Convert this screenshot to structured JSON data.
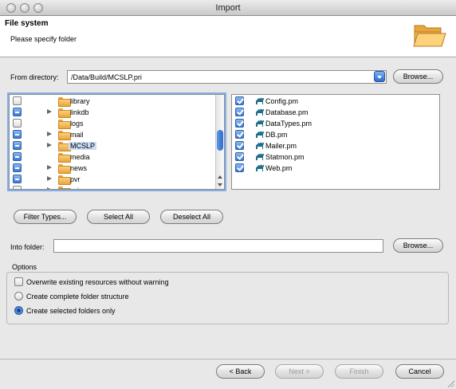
{
  "window": {
    "title": "Import"
  },
  "header": {
    "title": "File system",
    "subtitle": "Please specify folder",
    "icon": "folder-open-icon"
  },
  "from_directory": {
    "label": "From directory:",
    "value": "/Data/Build/MCSLP.pri",
    "browse_label": "Browse..."
  },
  "folder_tree": {
    "items": [
      {
        "label": "library",
        "check": "unchecked",
        "expander": false,
        "selected": false
      },
      {
        "label": "linkdb",
        "check": "mixed",
        "expander": true,
        "selected": false
      },
      {
        "label": "logs",
        "check": "unchecked",
        "expander": false,
        "selected": false
      },
      {
        "label": "mail",
        "check": "mixed",
        "expander": true,
        "selected": false
      },
      {
        "label": "MCSLP",
        "check": "mixed",
        "expander": true,
        "selected": true
      },
      {
        "label": "media",
        "check": "mixed",
        "expander": false,
        "selected": false
      },
      {
        "label": "news",
        "check": "mixed",
        "expander": true,
        "selected": false
      },
      {
        "label": "pvr",
        "check": "mixed",
        "expander": true,
        "selected": false
      },
      {
        "label": "ssi",
        "check": "unchecked",
        "expander": true,
        "selected": false
      }
    ]
  },
  "file_list": {
    "items": [
      {
        "label": "Config.pm",
        "checked": true,
        "icon": "perl-camel-icon"
      },
      {
        "label": "Database.pm",
        "checked": true,
        "icon": "perl-camel-icon"
      },
      {
        "label": "DataTypes.pm",
        "checked": true,
        "icon": "perl-camel-icon"
      },
      {
        "label": "DB.pm",
        "checked": true,
        "icon": "perl-camel-icon"
      },
      {
        "label": "Mailer.pm",
        "checked": true,
        "icon": "perl-camel-icon"
      },
      {
        "label": "Statmon.pm",
        "checked": true,
        "icon": "perl-camel-icon"
      },
      {
        "label": "Web.pm",
        "checked": true,
        "icon": "perl-camel-icon"
      }
    ]
  },
  "selection_buttons": {
    "filter_types": "Filter Types...",
    "select_all": "Select All",
    "deselect_all": "Deselect All"
  },
  "into_folder": {
    "label": "Into folder:",
    "value": "",
    "browse_label": "Browse..."
  },
  "options": {
    "title": "Options",
    "overwrite": {
      "label": "Overwrite existing resources without warning",
      "checked": false
    },
    "radios": [
      {
        "label": "Create complete folder structure",
        "selected": false
      },
      {
        "label": "Create selected folders only",
        "selected": true
      }
    ]
  },
  "footer": {
    "back": "< Back",
    "next": "Next >",
    "finish": "Finish",
    "cancel": "Cancel"
  },
  "colors": {
    "accent": "#2d6cd1",
    "folder": "#f2b54b",
    "selection": "#cbdcf5"
  }
}
